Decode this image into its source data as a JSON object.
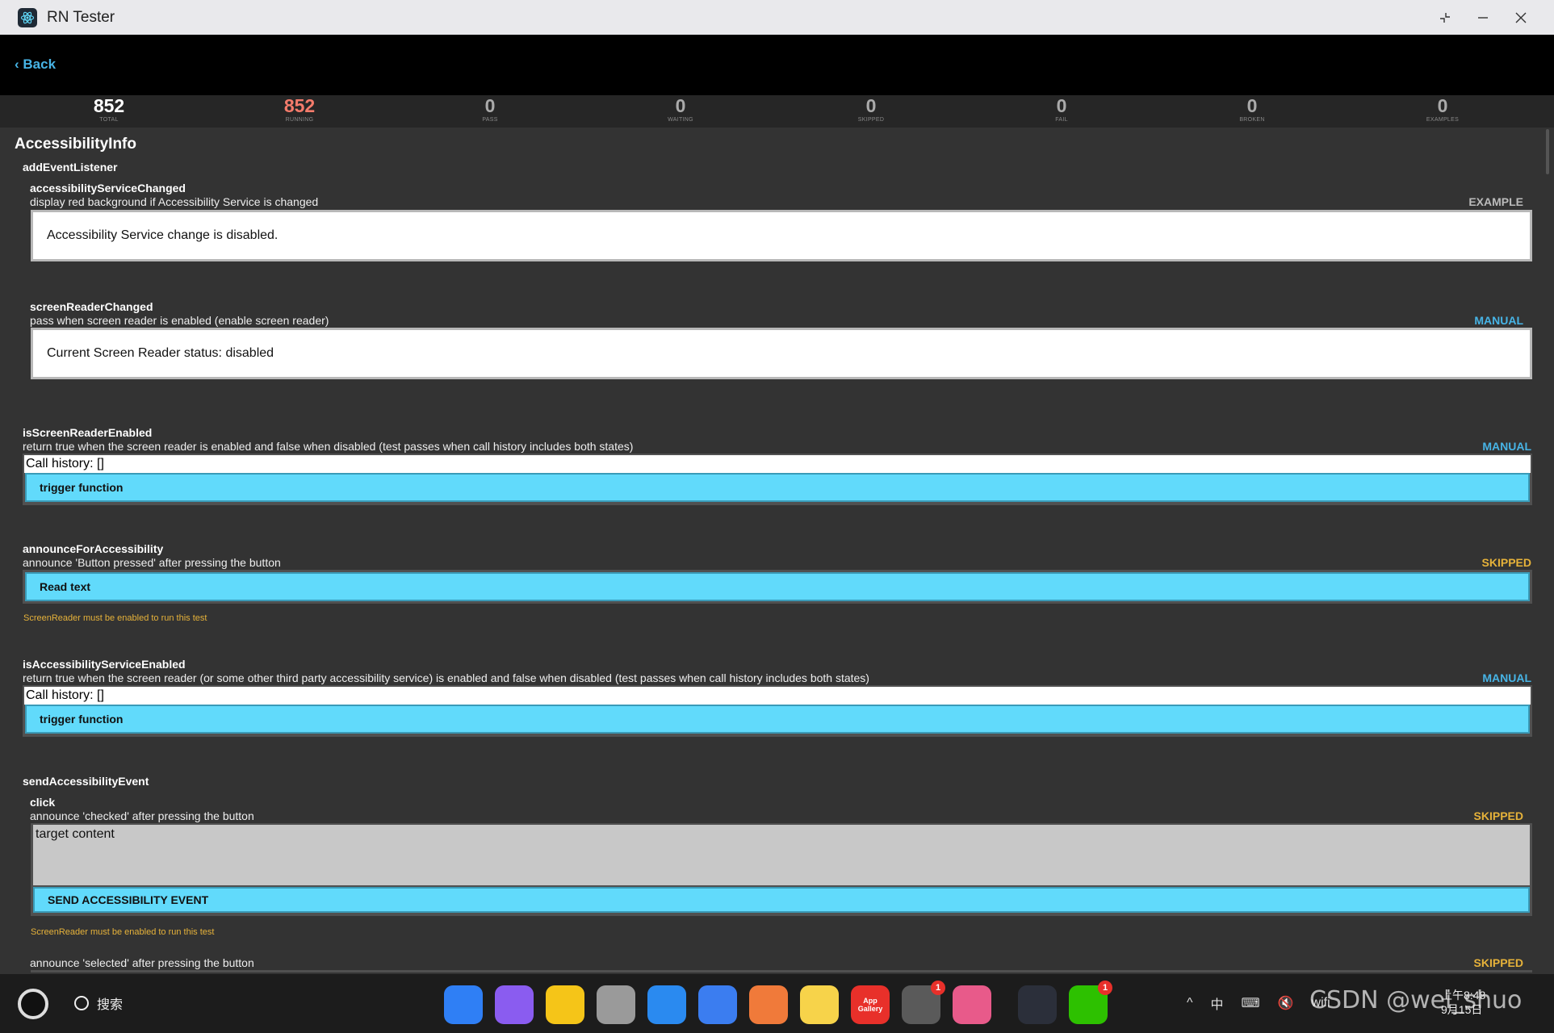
{
  "window": {
    "title": "RN Tester"
  },
  "nav": {
    "back_label": "‹ Back"
  },
  "stats": [
    {
      "value": "852",
      "label": "TOTAL",
      "color": "#ffffff"
    },
    {
      "value": "852",
      "label": "RUNNING",
      "color": "#f47b6b"
    },
    {
      "value": "0",
      "label": "PASS",
      "color": "#aaaaaa"
    },
    {
      "value": "0",
      "label": "WAITING",
      "color": "#aaaaaa"
    },
    {
      "value": "0",
      "label": "SKIPPED",
      "color": "#aaaaaa"
    },
    {
      "value": "0",
      "label": "FAIL",
      "color": "#aaaaaa"
    },
    {
      "value": "0",
      "label": "BROKEN",
      "color": "#aaaaaa"
    },
    {
      "value": "0",
      "label": "EXAMPLES",
      "color": "#aaaaaa"
    }
  ],
  "suite": {
    "title": "AccessibilityInfo",
    "group1": "addEventListener",
    "t1": {
      "name": "accessibilityServiceChanged",
      "desc": "display red background if Accessibility Service is changed",
      "tag": "EXAMPLE",
      "box": "Accessibility Service change is disabled."
    },
    "t2": {
      "name": "screenReaderChanged",
      "desc": "pass when screen reader is enabled (enable screen reader)",
      "tag": "MANUAL",
      "box": "Current Screen Reader status: disabled"
    },
    "t3": {
      "name": "isScreenReaderEnabled",
      "desc": "return true when the screen reader is enabled and false when disabled (test passes when call history includes both states)",
      "tag": "MANUAL",
      "history": "Call history: []",
      "button": "trigger function"
    },
    "t4": {
      "name": "announceForAccessibility",
      "desc": "announce 'Button pressed' after pressing the button",
      "tag": "SKIPPED",
      "button": "Read text",
      "warn": "ScreenReader must be enabled to run this test"
    },
    "t5": {
      "name": "isAccessibilityServiceEnabled",
      "desc": "return true when the screen reader (or some other third party accessibility service) is enabled and false when disabled (test passes when call history includes both states)",
      "tag": "MANUAL",
      "history": "Call history: []",
      "button": "trigger function"
    },
    "group2": "sendAccessibilityEvent",
    "t6": {
      "name": "click",
      "desc": "announce 'checked' after pressing the button",
      "tag": "SKIPPED",
      "target": "target content",
      "button": "SEND ACCESSIBILITY EVENT",
      "warn": "ScreenReader must be enabled to run this test"
    },
    "t7": {
      "desc": "announce 'selected' after pressing the button",
      "tag": "SKIPPED"
    }
  },
  "taskbar": {
    "search_label": "搜索",
    "apps": [
      {
        "name": "windows-grid",
        "color": "#2f7ff5",
        "label": ""
      },
      {
        "name": "multitask",
        "color": "#8a5cf0",
        "label": ""
      },
      {
        "name": "files",
        "color": "#f5c518",
        "label": ""
      },
      {
        "name": "trash",
        "color": "#9a9a9a",
        "label": ""
      },
      {
        "name": "browser",
        "color": "#2a8af0",
        "label": ""
      },
      {
        "name": "mail",
        "color": "#3b7df0",
        "label": ""
      },
      {
        "name": "photos",
        "color": "#f07a3a",
        "label": ""
      },
      {
        "name": "notes",
        "color": "#f7d34a",
        "label": ""
      },
      {
        "name": "app-gallery",
        "color": "#e8302a",
        "label": "App Gallery"
      },
      {
        "name": "settings",
        "color": "#5a5a5a",
        "label": "",
        "badge": "1"
      },
      {
        "name": "devtool",
        "color": "#e85a8a",
        "label": ""
      },
      {
        "name": "react",
        "color": "#2b2f3a",
        "label": ""
      },
      {
        "name": "wechat",
        "color": "#2dc100",
        "label": "",
        "badge": "1"
      }
    ],
    "tray_icons": [
      "^",
      "中",
      "⌨",
      "🔇",
      "wifi"
    ],
    "time": "上午8:48",
    "date": "9月15日"
  },
  "watermark": "CSDN @wei_shuo"
}
